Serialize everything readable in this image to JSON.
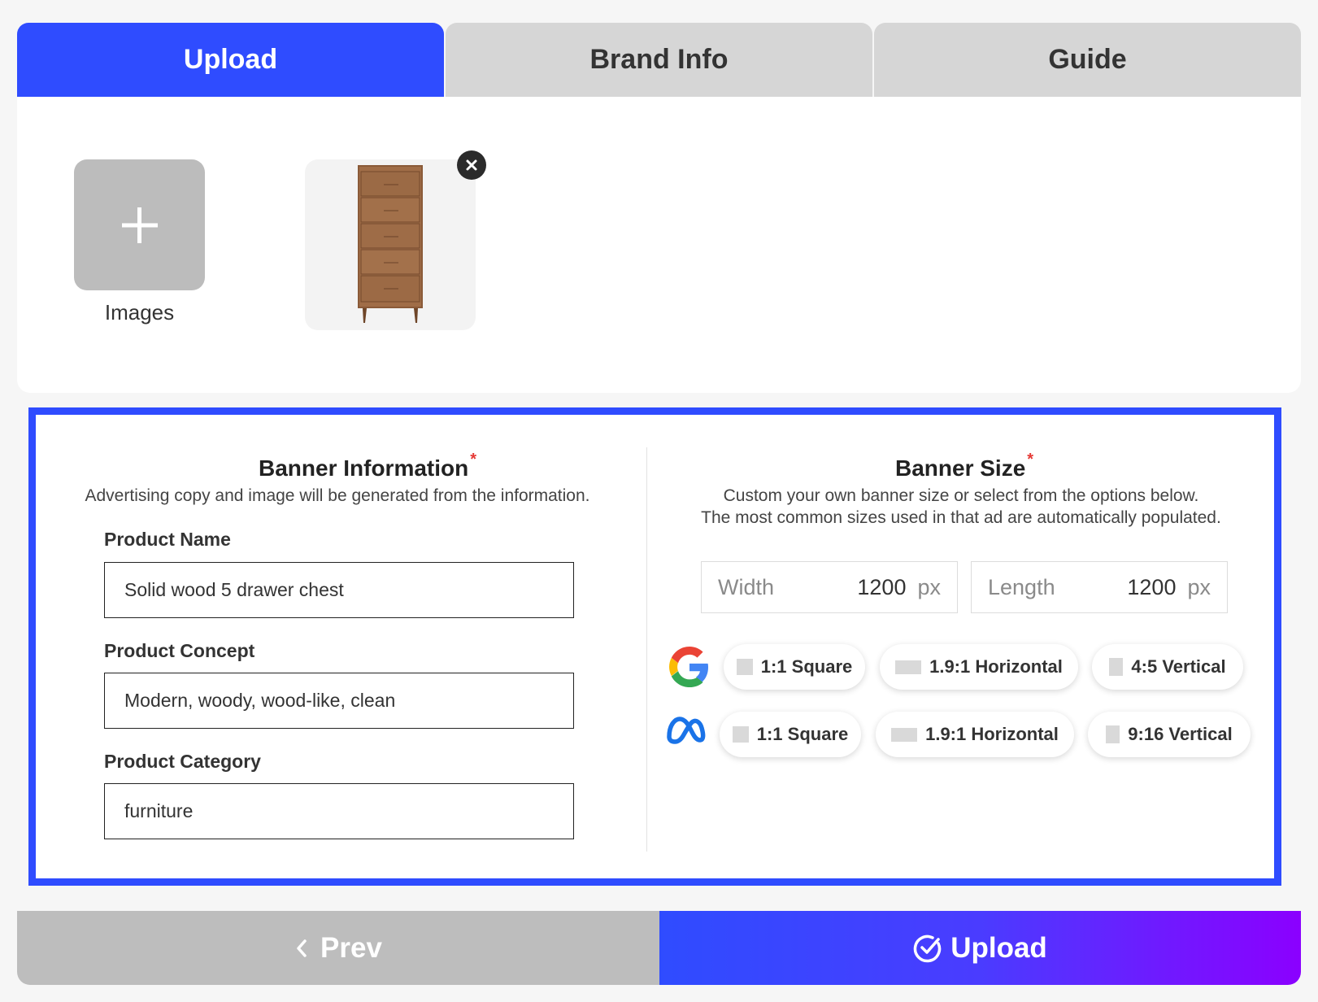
{
  "tabs": [
    {
      "label": "Upload",
      "active": true
    },
    {
      "label": "Brand Info",
      "active": false
    },
    {
      "label": "Guide",
      "active": false
    }
  ],
  "upload": {
    "add_label": "Images",
    "add_icon": "plus-icon",
    "thumbnail_icon": "dresser-image",
    "remove_icon": "close-icon"
  },
  "banner_info": {
    "title": "Banner Information",
    "required_mark": "*",
    "description": "Advertising copy and image will be generated from the information.",
    "fields": [
      {
        "label": "Product Name",
        "value": "Solid wood 5 drawer chest"
      },
      {
        "label": "Product Concept",
        "value": "Modern, woody, wood-like, clean"
      },
      {
        "label": "Product Category",
        "value": "furniture"
      }
    ]
  },
  "banner_size": {
    "title": "Banner Size",
    "required_mark": "*",
    "description_line1": "Custom your own banner size or select from the options below.",
    "description_line2": "The most common sizes used in that ad are automatically populated.",
    "width": {
      "label": "Width",
      "value": "1200",
      "unit": "px"
    },
    "length": {
      "label": "Length",
      "value": "1200",
      "unit": "px"
    },
    "google": {
      "icon": "google-icon",
      "options": [
        "1:1 Square",
        "1.9:1 Horizontal",
        "4:5 Vertical"
      ]
    },
    "meta": {
      "icon": "meta-icon",
      "options": [
        "1:1 Square",
        "1.9:1 Horizontal",
        "9:16 Vertical"
      ]
    }
  },
  "footer": {
    "prev_label": "Prev",
    "upload_label": "Upload",
    "prev_icon": "chevron-left-icon",
    "upload_icon": "check-circle-icon"
  },
  "colors": {
    "accent": "#2f4cff",
    "gradient_end": "#8b00ff",
    "required": "#e53935"
  }
}
